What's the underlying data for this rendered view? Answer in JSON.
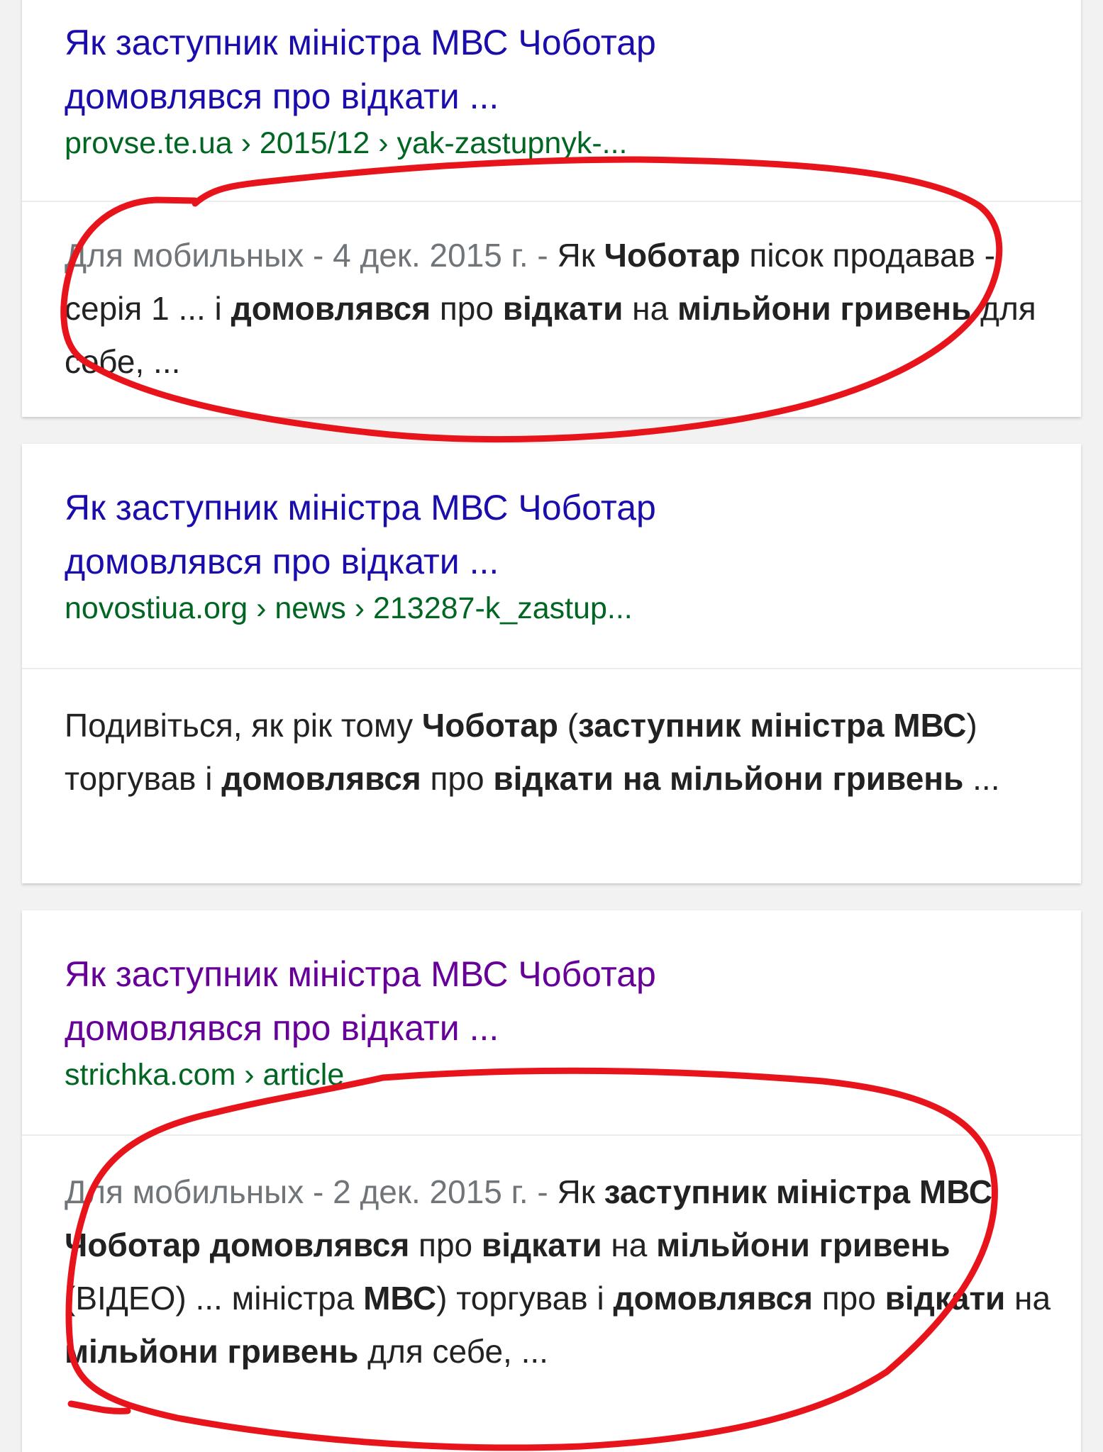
{
  "results": [
    {
      "title_line1": "Як заступник міністра МВС Чоботар",
      "title_line2": "домовлявся про відкати ...",
      "url": "provse.te.ua › 2015/12 › yak-zastupnyk-...",
      "snippet": {
        "meta": "Для мобильных - 4 дек. 2015 г. - ",
        "s1": "Як ",
        "s2": "Чоботар",
        "s3": " пісок продавав - серія 1 ... і ",
        "s4": "домовлявся",
        "s5": " про ",
        "s6": "відкати",
        "s7": " на ",
        "s8": "мільйони гривень",
        "s9": " для себе, ..."
      }
    },
    {
      "title_line1": "Як заступник міністра МВС Чоботар",
      "title_line2": "домовлявся про відкати ...",
      "url": "novostiua.org › news › 213287-k_zastup...",
      "snippet": {
        "s1": "Подивіться, як рік тому ",
        "s2": "Чоботар",
        "s3": " (",
        "s4": "заступник міністра МВС",
        "s5": ") торгував і ",
        "s6": "домовлявся",
        "s7": " про ",
        "s8": "відкати на мільйони гривень",
        "s9": " ..."
      }
    },
    {
      "title_line1": "Як заступник міністра МВС Чоботар",
      "title_line2": "домовлявся про відкати ...",
      "url": "strichka.com › article",
      "snippet": {
        "meta": "Для мобильных - 2 дек. 2015 г. - ",
        "s1": "Як ",
        "s2": "заступник міністра МВС Чоботар домовлявся",
        "s3": " про ",
        "s4": "відкати",
        "s5": " на ",
        "s6": "мільйони гривень",
        "s7": " (ВІДЕО) ... міністра ",
        "s8": "МВС",
        "s9": ") торгував і ",
        "s10": "домовлявся",
        "s11": " про ",
        "s12": "відкати",
        "s13": " на ",
        "s14": "мільйони гривень",
        "s15": " для себе, ..."
      }
    }
  ],
  "colors": {
    "title_link": "#1a0dab",
    "title_visited": "#660099",
    "url": "#006621",
    "annotation": "#e8141c"
  }
}
